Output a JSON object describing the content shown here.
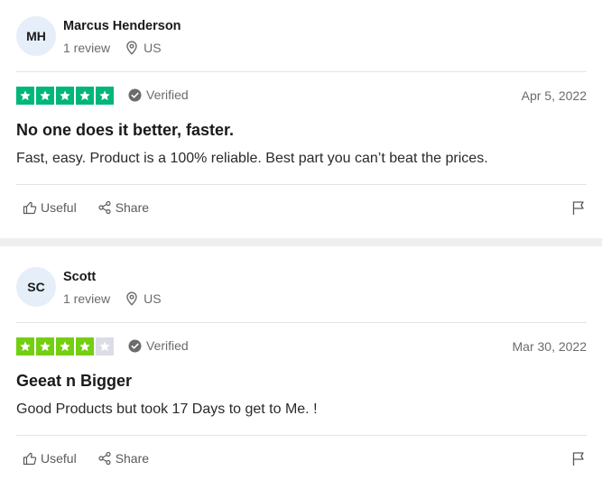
{
  "reviews": [
    {
      "initials": "MH",
      "name": "Marcus Henderson",
      "review_count": "1 review",
      "location": "US",
      "rating": 5,
      "star_color": "#00b67a",
      "verified_label": "Verified",
      "date": "Apr 5, 2022",
      "title": "No one does it better, faster.",
      "body": "Fast, easy. Product is a 100% reliable. Best part you can’t beat the prices.",
      "useful_label": "Useful",
      "share_label": "Share"
    },
    {
      "initials": "SC",
      "name": "Scott",
      "review_count": "1 review",
      "location": "US",
      "rating": 4,
      "star_color": "#73cf11",
      "verified_label": "Verified",
      "date": "Mar 30, 2022",
      "title": "Geeat n Bigger",
      "body": "Good Products but took 17 Days to get to Me. !",
      "useful_label": "Useful",
      "share_label": "Share"
    }
  ],
  "colors": {
    "empty_star": "#dcdce6",
    "avatar_bg": "#e5eef9",
    "muted_text": "#6b6b6b"
  }
}
